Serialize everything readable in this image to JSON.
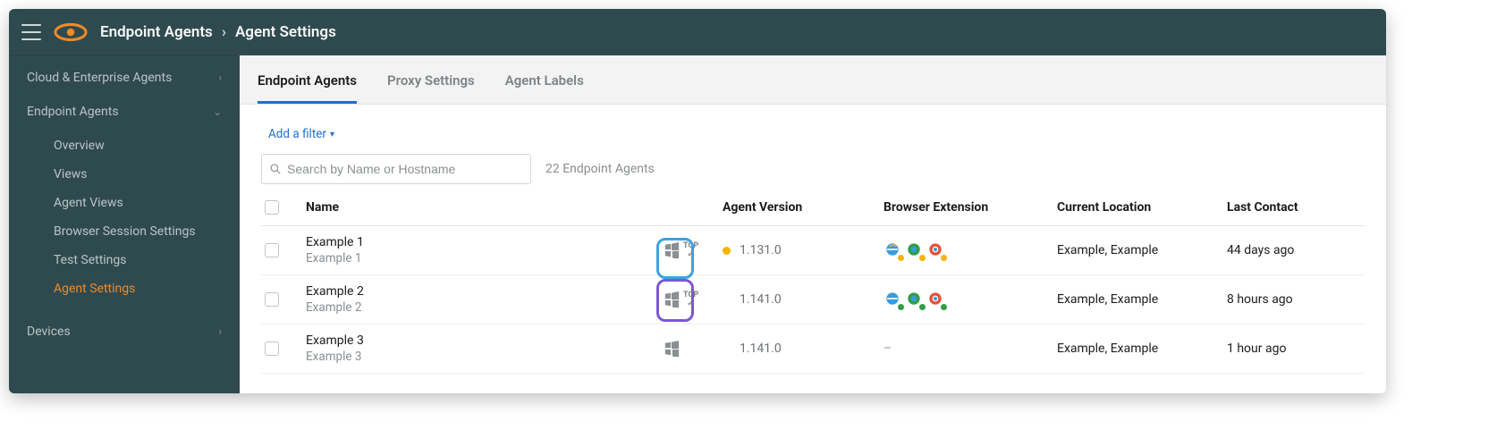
{
  "breadcrumb": {
    "section": "Endpoint Agents",
    "page": "Agent Settings"
  },
  "sidebar": {
    "sections": [
      {
        "label": "Cloud & Enterprise Agents",
        "expanded": false
      },
      {
        "label": "Endpoint Agents",
        "expanded": true,
        "items": [
          {
            "label": "Overview"
          },
          {
            "label": "Views"
          },
          {
            "label": "Agent Views"
          },
          {
            "label": "Browser Session Settings"
          },
          {
            "label": "Test Settings"
          },
          {
            "label": "Agent Settings",
            "active": true
          }
        ]
      },
      {
        "label": "Devices",
        "expanded": false
      }
    ]
  },
  "tabs": [
    {
      "label": "Endpoint Agents",
      "active": true
    },
    {
      "label": "Proxy Settings"
    },
    {
      "label": "Agent Labels"
    }
  ],
  "filter_link": "Add a filter",
  "search": {
    "placeholder": "Search by Name or Hostname"
  },
  "count_text": "22 Endpoint Agents",
  "columns": {
    "name": "Name",
    "version": "Agent Version",
    "extension": "Browser Extension",
    "location": "Current Location",
    "last": "Last Contact"
  },
  "rows": [
    {
      "name": "Example 1",
      "sub": "Example 1",
      "os": "windows",
      "tcp": true,
      "version": "1.131.0",
      "version_warn": true,
      "ext_status": "warn",
      "location": "Example, Example",
      "last": "44 days ago"
    },
    {
      "name": "Example 2",
      "sub": "Example 2",
      "os": "windows",
      "tcp": true,
      "version": "1.141.0",
      "version_warn": false,
      "ext_status": "ok",
      "location": "Example, Example",
      "last": "8 hours ago"
    },
    {
      "name": "Example 3",
      "sub": "Example 3",
      "os": "windows",
      "tcp": false,
      "version": "1.141.0",
      "version_warn": false,
      "ext_status": "none",
      "location": "Example, Example",
      "last": "1 hour ago"
    }
  ]
}
